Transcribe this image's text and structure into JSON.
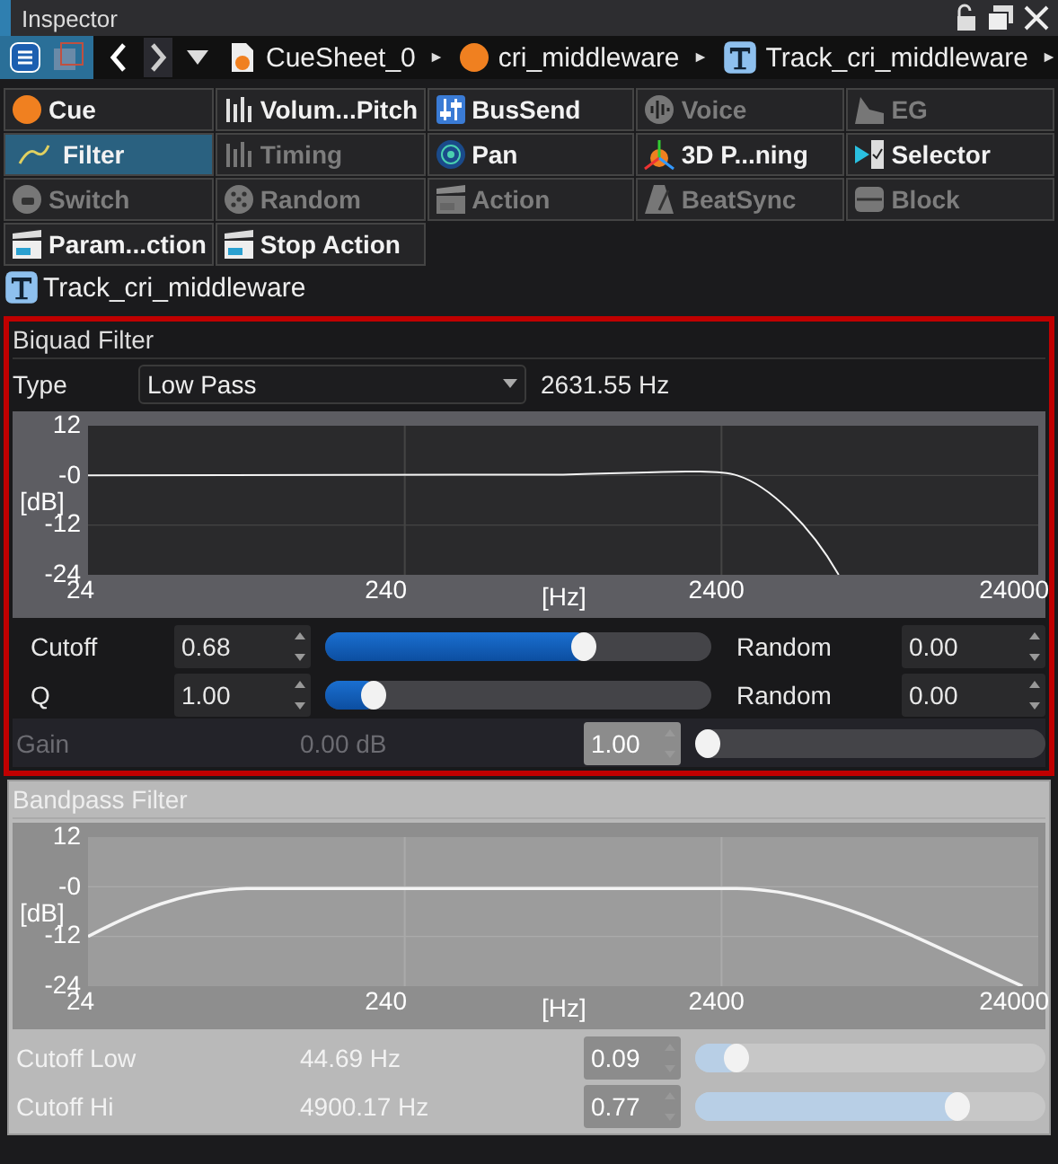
{
  "window": {
    "title": "Inspector"
  },
  "breadcrumb": [
    {
      "kind": "sheet",
      "label": "CueSheet_0"
    },
    {
      "kind": "orb",
      "label": "cri_middleware"
    },
    {
      "kind": "track",
      "label": "Track_cri_middleware"
    }
  ],
  "tabs": [
    {
      "label": "Cue",
      "kind": "orb",
      "enabled": true,
      "selected": false
    },
    {
      "label": "Volum...Pitch",
      "kind": "bars",
      "enabled": true,
      "selected": false
    },
    {
      "label": "BusSend",
      "kind": "faders",
      "enabled": true,
      "selected": false
    },
    {
      "label": "Voice",
      "kind": "wave",
      "enabled": false,
      "selected": false
    },
    {
      "label": "EG",
      "kind": "envelope",
      "enabled": false,
      "selected": false
    },
    {
      "label": "Filter",
      "kind": "filter",
      "enabled": true,
      "selected": true
    },
    {
      "label": "Timing",
      "kind": "bars",
      "enabled": false,
      "selected": false
    },
    {
      "label": "Pan",
      "kind": "radar",
      "enabled": true,
      "selected": false
    },
    {
      "label": "3D P...ning",
      "kind": "axes",
      "enabled": true,
      "selected": false
    },
    {
      "label": "Selector",
      "kind": "selector",
      "enabled": true,
      "selected": false
    },
    {
      "label": "Switch",
      "kind": "switch",
      "enabled": false,
      "selected": false
    },
    {
      "label": "Random",
      "kind": "dice",
      "enabled": false,
      "selected": false
    },
    {
      "label": "Action",
      "kind": "clapper",
      "enabled": false,
      "selected": false
    },
    {
      "label": "BeatSync",
      "kind": "metronome",
      "enabled": false,
      "selected": false
    },
    {
      "label": "Block",
      "kind": "block",
      "enabled": false,
      "selected": false
    },
    {
      "label": "Param...ction",
      "kind": "clapper",
      "enabled": true,
      "selected": false
    },
    {
      "label": "Stop Action",
      "kind": "clapper",
      "enabled": true,
      "selected": false
    }
  ],
  "target": {
    "label": "Track_cri_middleware"
  },
  "panels": [
    {
      "title": "Biquad Filter",
      "enabled": true,
      "highlighted": true,
      "kind": "lowpass",
      "type_row": {
        "label": "Type",
        "value": "Low Pass",
        "reading": "2631.55 Hz"
      },
      "y_ticks": [
        "12",
        "-0",
        "-12",
        "-24"
      ],
      "y_unit": "[dB]",
      "x_ticks": [
        "24",
        "240",
        "2400",
        "24000"
      ],
      "x_unit": "[Hz]",
      "rows": [
        {
          "kind": "param",
          "label": "Cutoff",
          "value": "0.68",
          "level": 0.68,
          "random_label": "Random",
          "random_value": "0.00"
        },
        {
          "kind": "param",
          "label": "Q",
          "value": "1.00",
          "level": 0.1,
          "random_label": "Random",
          "random_value": "0.00"
        },
        {
          "kind": "readout",
          "label": "Gain",
          "reading": "0.00 dB",
          "value": "1.00",
          "level": 0,
          "disabled": true
        }
      ]
    },
    {
      "title": "Bandpass Filter",
      "enabled": false,
      "highlighted": false,
      "kind": "bandpass",
      "y_ticks": [
        "12",
        "-0",
        "-12",
        "-24"
      ],
      "y_unit": "[dB]",
      "x_ticks": [
        "24",
        "240",
        "2400",
        "24000"
      ],
      "x_unit": "[Hz]",
      "rows": [
        {
          "kind": "readout",
          "label": "Cutoff Low",
          "reading": "44.69 Hz",
          "value": "0.09",
          "level": 0.09,
          "disabled": false
        },
        {
          "kind": "readout",
          "label": "Cutoff Hi",
          "reading": "4900.17 Hz",
          "value": "0.77",
          "level": 0.77,
          "disabled": false
        }
      ]
    }
  ]
}
